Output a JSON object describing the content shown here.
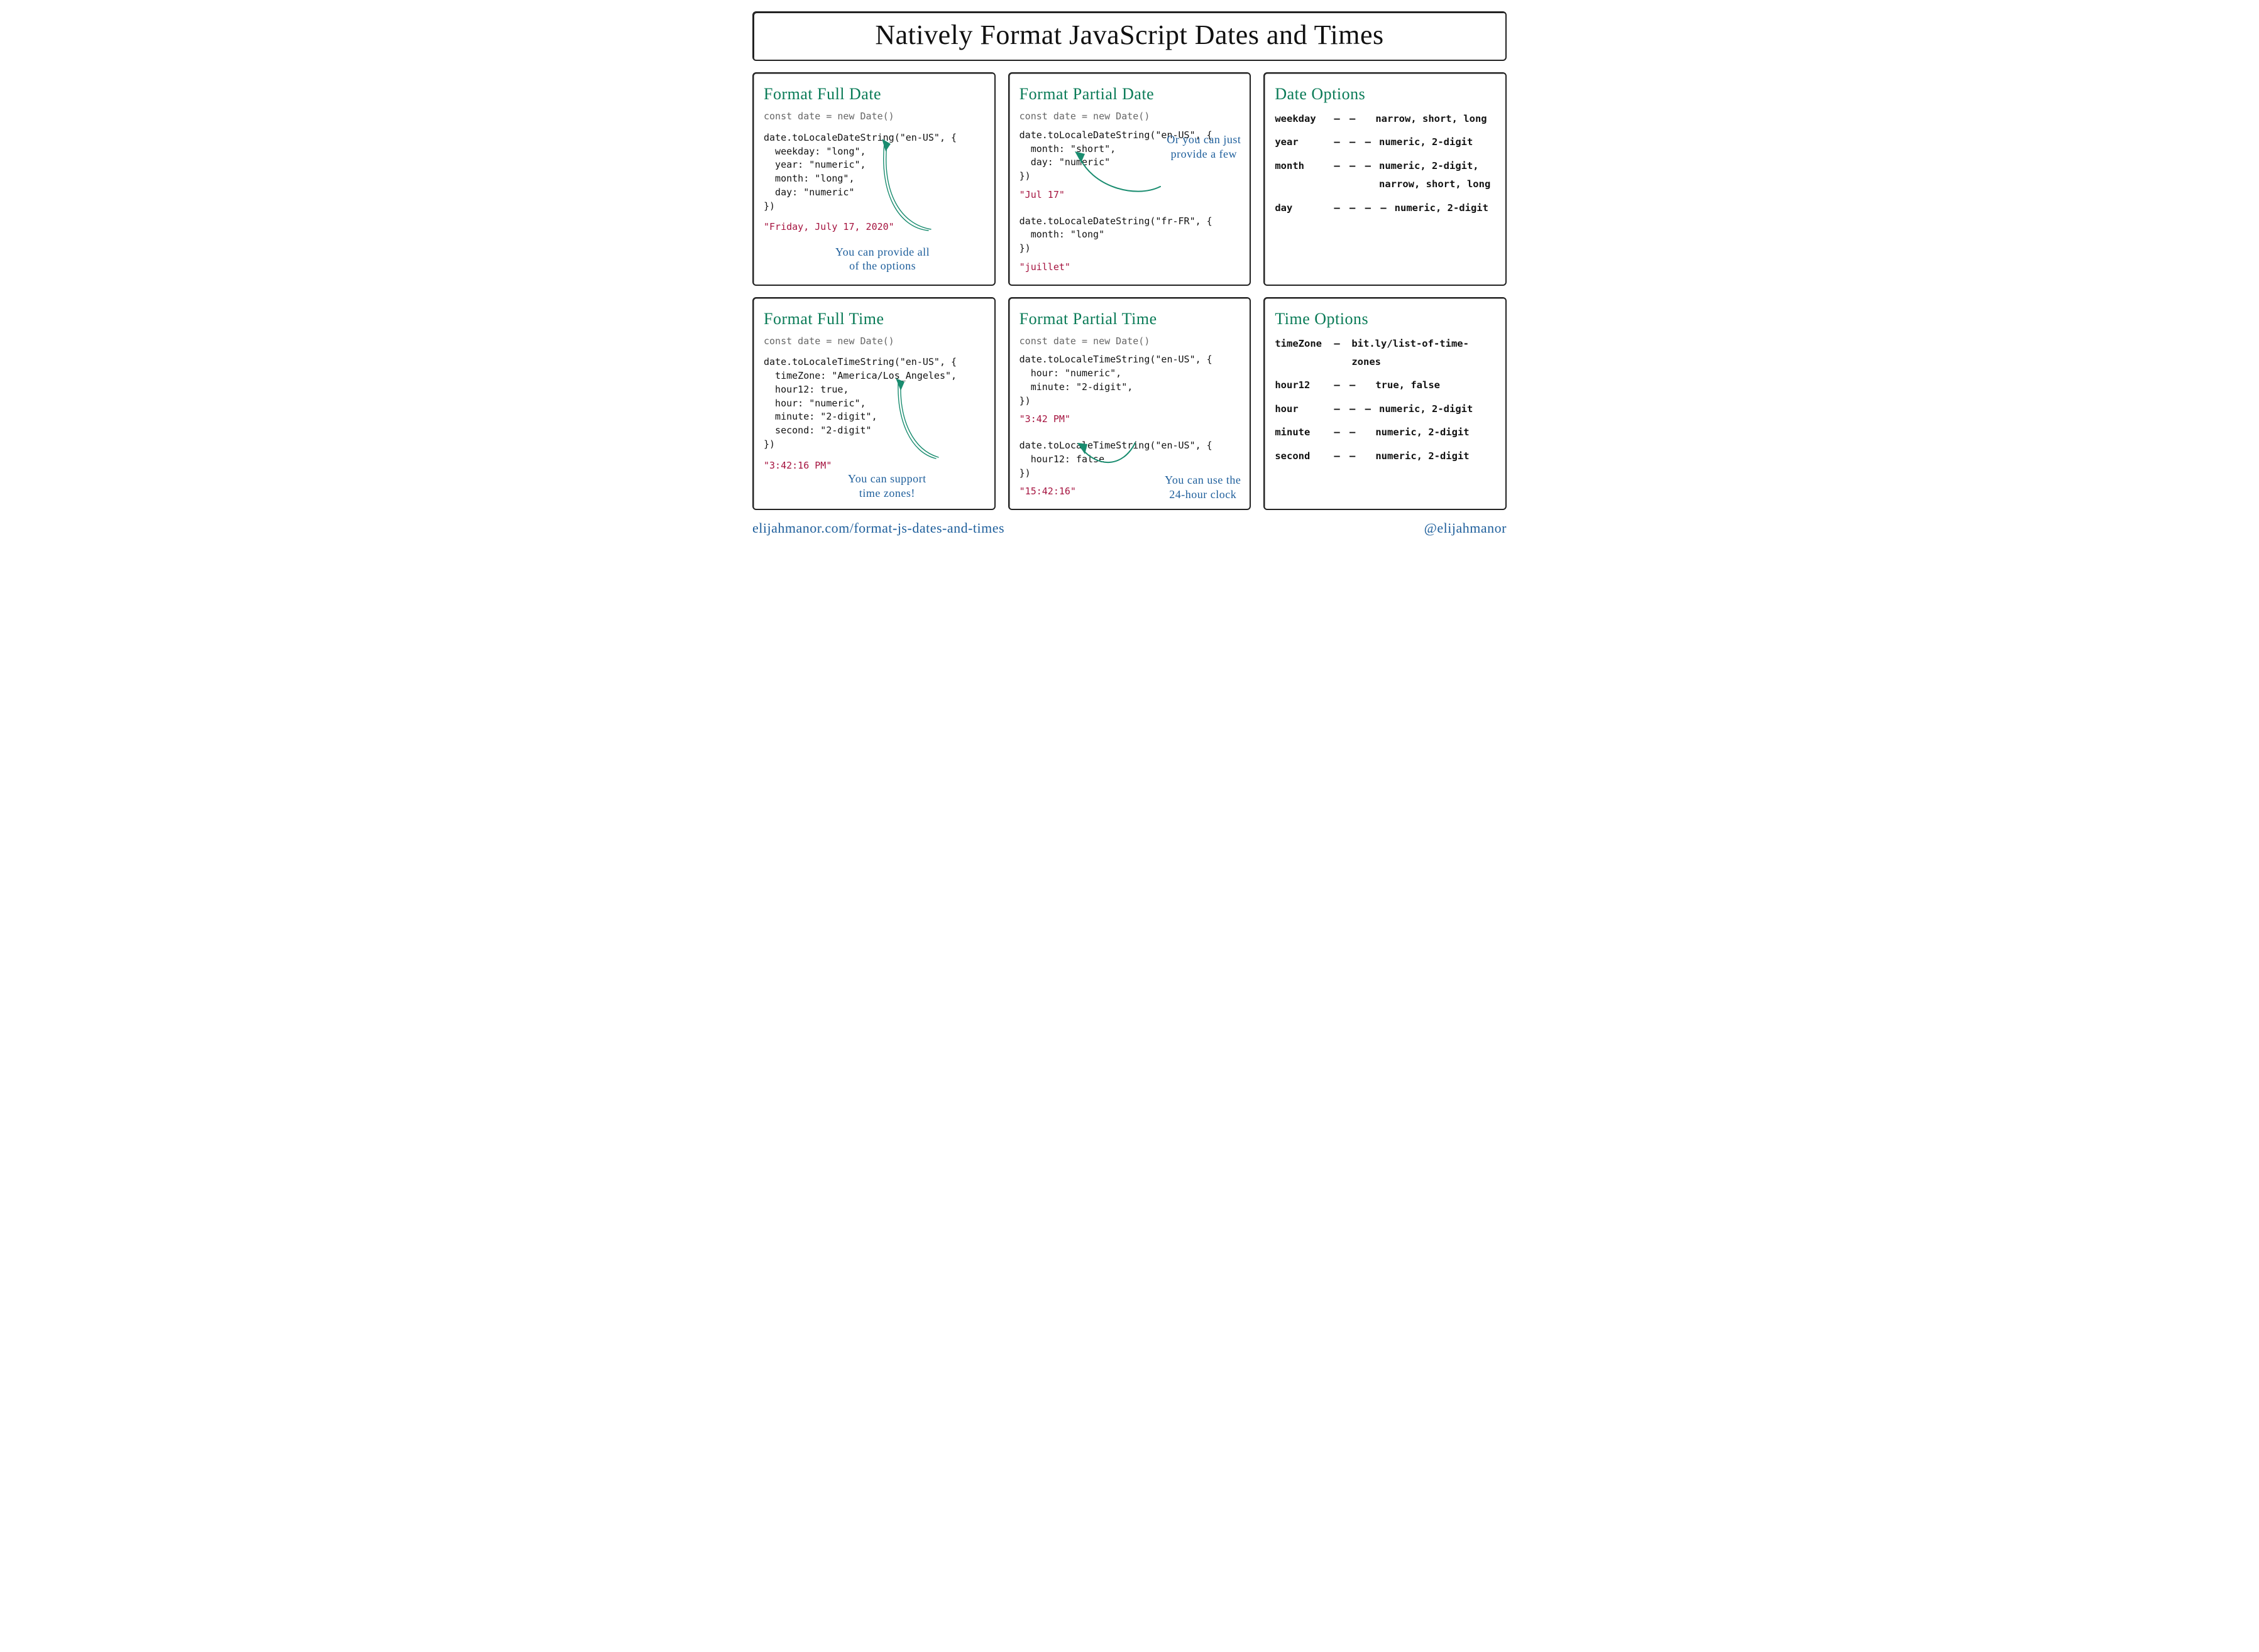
{
  "title": "Natively Format JavaScript Dates and Times",
  "footer": {
    "url": "elijahmanor.com/format-js-dates-and-times",
    "handle": "@elijahmanor"
  },
  "cards": {
    "fullDate": {
      "heading": "Format Full Date",
      "decl": "const date = new Date()",
      "code": "date.toLocaleDateString(\"en-US\", {\n  weekday: \"long\",\n  year: \"numeric\",\n  month: \"long\",\n  day: \"numeric\"\n})",
      "output": "\"Friday, July 17, 2020\"",
      "note": "You can provide all\nof the options"
    },
    "partialDate": {
      "heading": "Format Partial Date",
      "decl": "const date = new Date()",
      "code1": "date.toLocaleDateString(\"en-US\", {\n  month: \"short\",\n  day: \"numeric\"\n})",
      "out1": "\"Jul 17\"",
      "code2": "date.toLocaleDateString(\"fr-FR\", {\n  month: \"long\"\n})",
      "out2": "\"juillet\"",
      "note": "Or you can just\nprovide a few"
    },
    "dateOptions": {
      "heading": "Date Options",
      "rows": [
        {
          "key": "weekday",
          "dash": "— —",
          "vals": "narrow, short, long"
        },
        {
          "key": "year",
          "dash": "— — —",
          "vals": "numeric, 2-digit"
        },
        {
          "key": "month",
          "dash": "— — —",
          "vals": "numeric, 2-digit,\nnarrow, short, long"
        },
        {
          "key": "day",
          "dash": "— — — —",
          "vals": "numeric, 2-digit"
        }
      ]
    },
    "fullTime": {
      "heading": "Format Full Time",
      "decl": "const date = new Date()",
      "code": "date.toLocaleTimeString(\"en-US\", {\n  timeZone: \"America/Los_Angeles\",\n  hour12: true,\n  hour: \"numeric\",\n  minute: \"2-digit\",\n  second: \"2-digit\"\n})",
      "output": "\"3:42:16 PM\"",
      "note": "You can support\ntime zones!"
    },
    "partialTime": {
      "heading": "Format Partial Time",
      "decl": "const date = new Date()",
      "code1": "date.toLocaleTimeString(\"en-US\", {\n  hour: \"numeric\",\n  minute: \"2-digit\",\n})",
      "out1": "\"3:42 PM\"",
      "code2": "date.toLocaleTimeString(\"en-US\", {\n  hour12: false\n})",
      "out2": "\"15:42:16\"",
      "note": "You can use the\n24-hour clock"
    },
    "timeOptions": {
      "heading": "Time Options",
      "rows": [
        {
          "key": "timeZone",
          "dash": "—",
          "vals": "bit.ly/list-of-time-zones"
        },
        {
          "key": "hour12",
          "dash": "— —",
          "vals": "true, false"
        },
        {
          "key": "hour",
          "dash": "— — —",
          "vals": "numeric, 2-digit"
        },
        {
          "key": "minute",
          "dash": "— —",
          "vals": "numeric, 2-digit"
        },
        {
          "key": "second",
          "dash": "— —",
          "vals": "numeric, 2-digit"
        }
      ]
    }
  }
}
